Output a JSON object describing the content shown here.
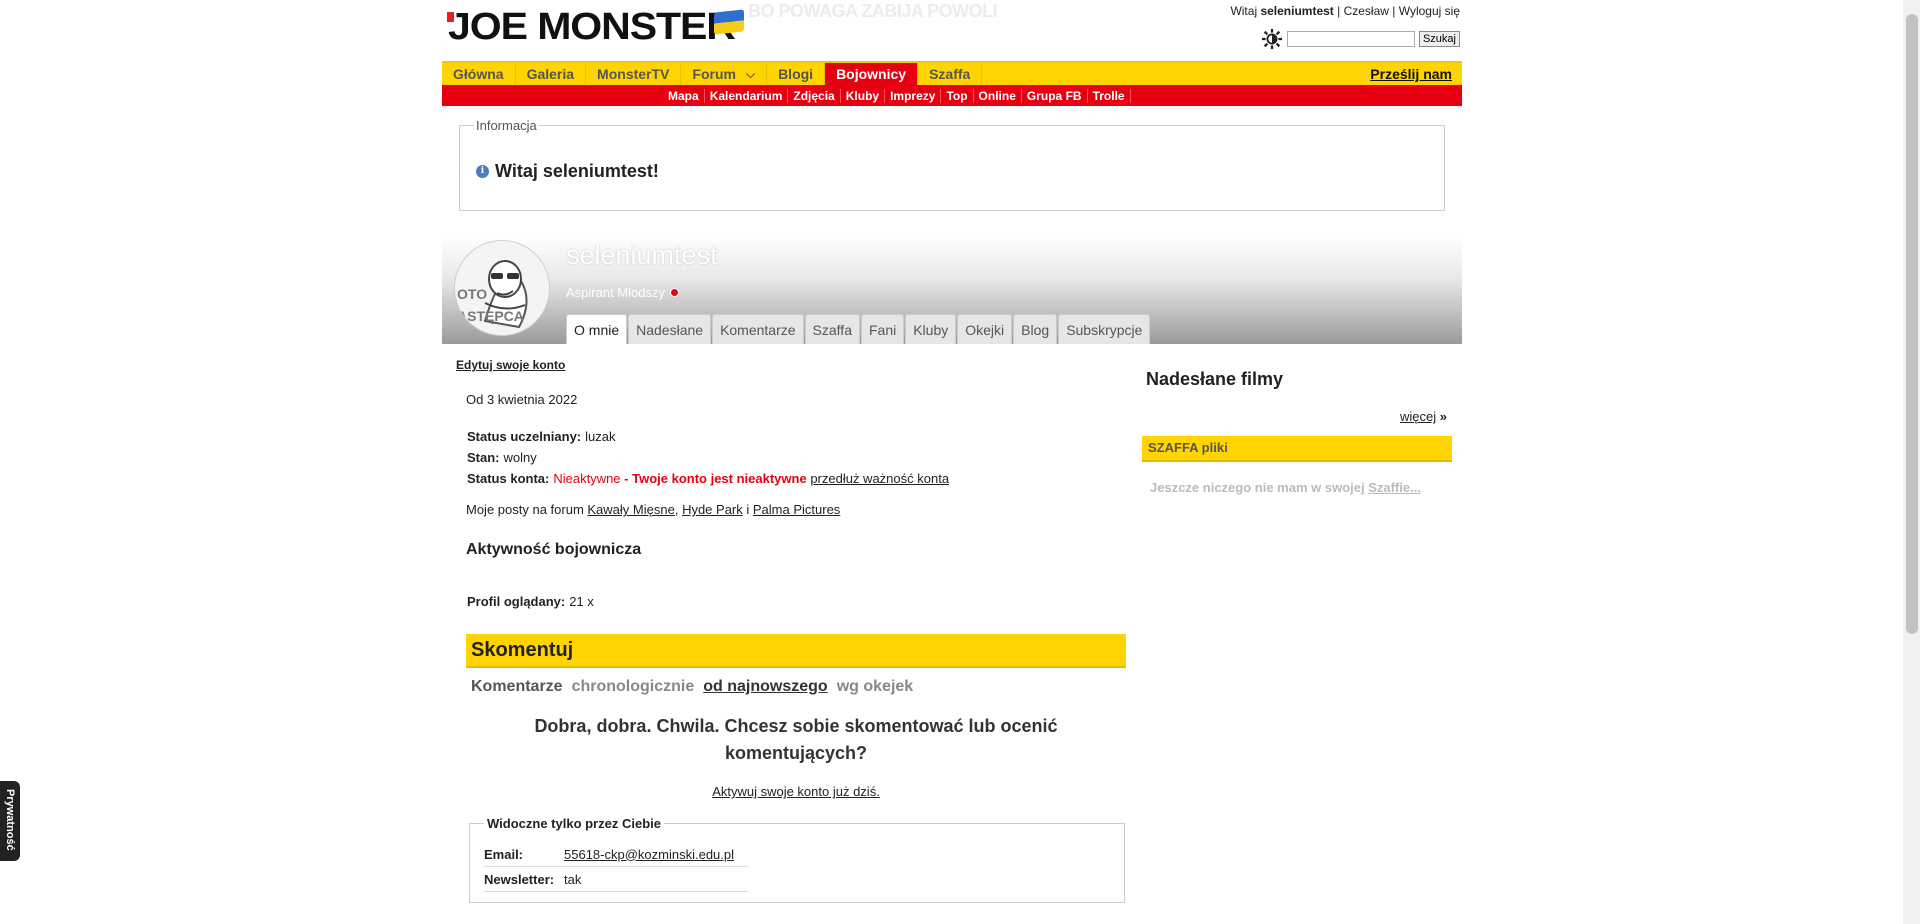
{
  "header": {
    "logo_text": "JOE MONSTER",
    "slogan": "BO POWAGA ZABIJA POWOLI",
    "greeting_prefix": "Witaj ",
    "username": "seleniumtest",
    "link_czeslaw": "Czesław",
    "link_logout": "Wyloguj się",
    "search_placeholder": "",
    "search_button": "Szukaj"
  },
  "nav": {
    "items": [
      "Główna",
      "Galeria",
      "MonsterTV",
      "Forum",
      "Blogi",
      "Bojownicy",
      "Szaffa"
    ],
    "active": "Bojownicy",
    "submit": "Prześlij nam"
  },
  "subnav": {
    "items": [
      "Mapa",
      "Kalendarium",
      "Zdjęcia",
      "Kluby",
      "Imprezy",
      "Top",
      "Online",
      "Grupa FB",
      "Trolle"
    ]
  },
  "info": {
    "legend": "Informacja",
    "message": "Witaj seleniumtest!"
  },
  "profile": {
    "username": "seleniumtest",
    "rank": "Aspirant Młodszy",
    "avatar_caption_1": "OTO",
    "avatar_caption_2": "ASTĘPCA",
    "tabs": [
      "O mnie",
      "Nadesłane",
      "Komentarze",
      "Szaffa",
      "Fani",
      "Kluby",
      "Okejki",
      "Blog",
      "Subskrypcje"
    ],
    "active_tab": "O mnie"
  },
  "about": {
    "edit_link": "Edytuj swoje konto",
    "since": "Od 3 kwietnia 2022",
    "status_label": "Status uczelniany:",
    "status_value": "luzak",
    "state_label": "Stan:",
    "state_value": "wolny",
    "account_label": "Status konta:",
    "account_value": "Nieaktywne",
    "account_sep": " - ",
    "account_warning": "Twoje konto jest nieaktywne",
    "account_extend": "przedłuż ważność konta",
    "posts_prefix": "Moje posty na forum ",
    "forum_1": "Kawały Mięsne",
    "forum_sep": ", ",
    "forum_2": "Hyde Park",
    "forum_and": " i ",
    "forum_3": "Palma Pictures",
    "activity_heading": "Aktywność bojownicza",
    "views_label": "Profil oglądany:",
    "views_value": "21 x"
  },
  "comments": {
    "bar_title": "Skomentuj",
    "sort_label": "Komentarze",
    "sort_options": [
      "chronologicznie",
      "od najnowszego",
      "wg okejek"
    ],
    "sort_selected": "od najnowszego",
    "prompt": "Dobra, dobra. Chwila. Chcesz sobie skomentować lub ocenić komentujących?",
    "activate_link": "Aktywuj swoje konto już dziś."
  },
  "private": {
    "legend": "Widoczne tylko przez Ciebie",
    "email_label": "Email:",
    "email_value": "55618-ckp@kozminski.edu.pl",
    "newsletter_label": "Newsletter:",
    "newsletter_value": "tak"
  },
  "sidebar": {
    "title": "Nadesłane filmy",
    "more": "więcej",
    "more_arrow": "»",
    "szaffa_title": "SZAFFA pliki",
    "szaffa_empty_prefix": "Jeszcze niczego nie mam w swojej ",
    "szaffa_empty_link": "Szaffie..."
  },
  "privacy_tab": "Prywatność",
  "colors": {
    "brand_yellow": "#ffd400",
    "brand_red": "#e60012"
  }
}
